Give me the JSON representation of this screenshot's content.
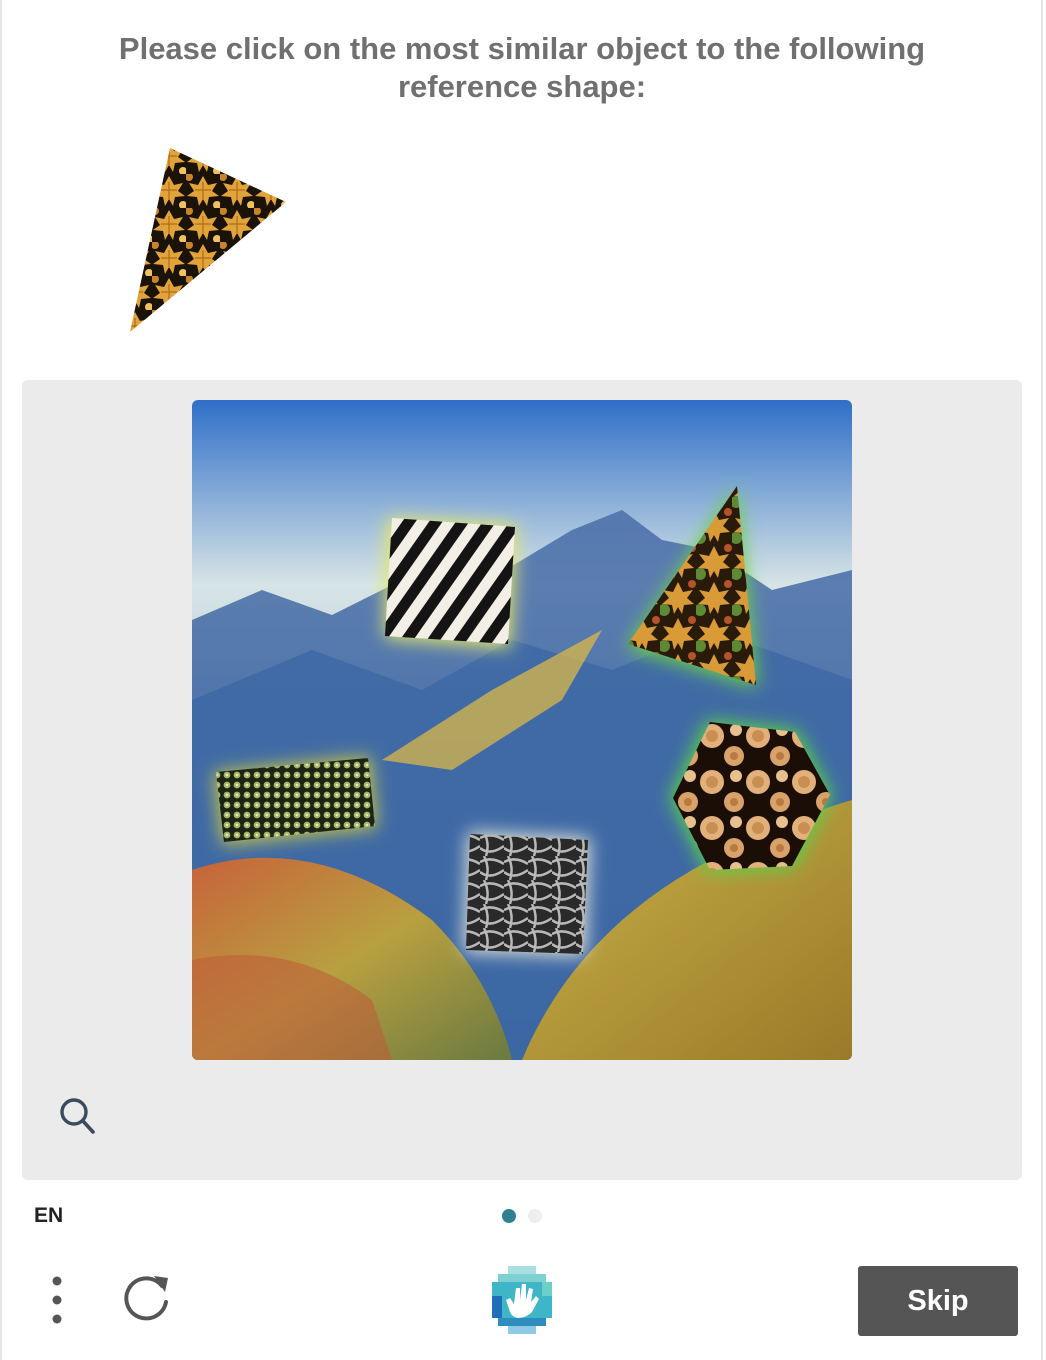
{
  "prompt": {
    "line1": "Please click on the most similar object to the following",
    "line2": "reference shape:"
  },
  "reference": {
    "shape": "triangle",
    "texture": "autumn-leaves"
  },
  "task_image": {
    "background": "mountain-landscape",
    "objects": [
      {
        "shape": "square",
        "texture": "zebra-stripes"
      },
      {
        "shape": "triangle",
        "texture": "autumn-leaves"
      },
      {
        "shape": "rectangle",
        "texture": "snakeskin"
      },
      {
        "shape": "hexagon",
        "texture": "wood-logs"
      },
      {
        "shape": "square",
        "texture": "cables"
      }
    ]
  },
  "footer": {
    "language": "EN",
    "page_dots": [
      {
        "state": "active",
        "color": "#2f8092"
      },
      {
        "state": "inactive",
        "color": "#eeeeee"
      }
    ],
    "skip_label": "Skip"
  },
  "icons": {
    "zoom": "search-icon",
    "menu": "more-vertical-icon",
    "refresh": "refresh-icon",
    "logo": "hcaptcha-hand-logo"
  },
  "colors": {
    "accent": "#2f8092",
    "skip_button": "#555555",
    "panel": "#ebebeb",
    "prompt_text": "#707070"
  }
}
